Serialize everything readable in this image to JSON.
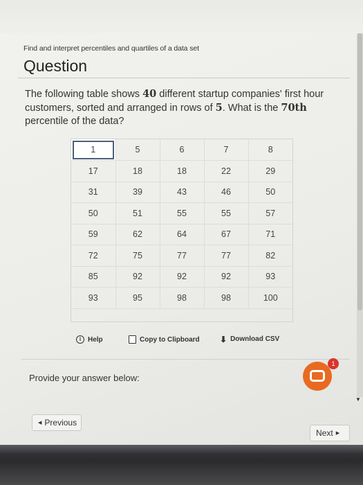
{
  "header": {
    "subtitle": "Find and interpret percentiles and quartiles of a data set",
    "title": "Question"
  },
  "prompt": {
    "part1": "The following table shows ",
    "count": "40",
    "part2": " different startup companies' first hour customers, sorted and arranged in rows of ",
    "rowsize": "5",
    "part3": ". What is the ",
    "percentile": "70th",
    "part4": " percentile of the data?"
  },
  "table": {
    "rows": [
      [
        "1",
        "5",
        "6",
        "7",
        "8"
      ],
      [
        "17",
        "18",
        "18",
        "22",
        "29"
      ],
      [
        "31",
        "39",
        "43",
        "46",
        "50"
      ],
      [
        "50",
        "51",
        "55",
        "55",
        "57"
      ],
      [
        "59",
        "62",
        "64",
        "67",
        "71"
      ],
      [
        "72",
        "75",
        "77",
        "77",
        "82"
      ],
      [
        "85",
        "92",
        "92",
        "92",
        "93"
      ],
      [
        "93",
        "95",
        "98",
        "98",
        "100"
      ]
    ]
  },
  "tools": {
    "help_label": "Help",
    "help_icon": "info-circle-icon",
    "copy_label": "Copy to Clipboard",
    "copy_icon": "clipboard-icon",
    "download_label": "Download CSV",
    "download_icon": "download-arrow-icon"
  },
  "answer": {
    "label": "Provide your answer below:",
    "value": ""
  },
  "chat": {
    "icon": "chat-bubble-icon",
    "badge": "1",
    "color": "#e86a22"
  },
  "nav": {
    "previous_label": "Previous",
    "next_label": "Next"
  }
}
